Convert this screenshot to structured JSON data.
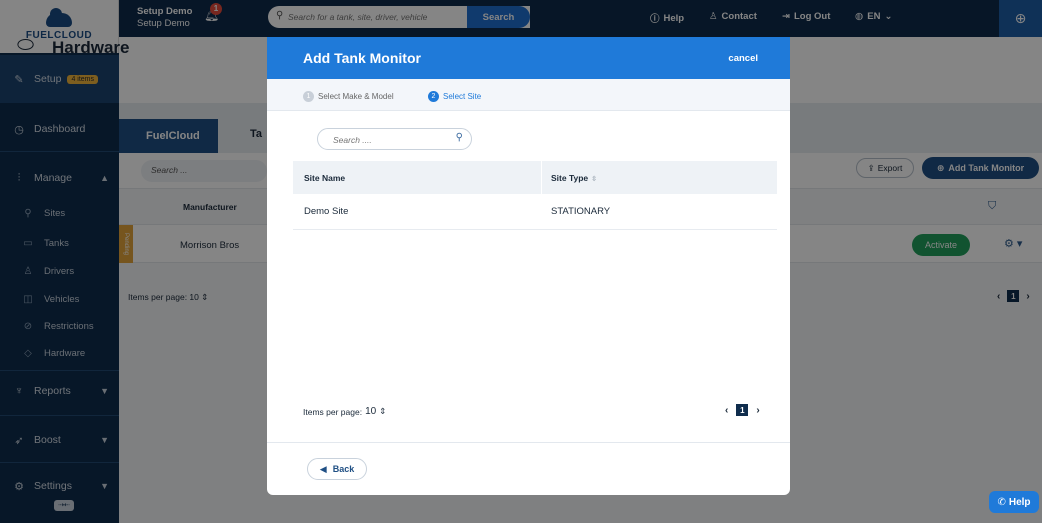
{
  "brand": {
    "logo_text": "FUELCLOUD"
  },
  "sidebar": {
    "setup_label": "Setup",
    "setup_badge": "4 items",
    "dashboard_label": "Dashboard",
    "manage_label": "Manage",
    "manage_items": [
      {
        "label": "Sites",
        "icon": "pin-icon"
      },
      {
        "label": "Tanks",
        "icon": "tank-icon"
      },
      {
        "label": "Drivers",
        "icon": "driver-icon"
      },
      {
        "label": "Vehicles",
        "icon": "vehicle-icon"
      },
      {
        "label": "Restrictions",
        "icon": "restriction-icon"
      },
      {
        "label": "Hardware",
        "icon": "hardware-icon"
      }
    ],
    "reports_label": "Reports",
    "boost_label": "Boost",
    "settings_label": "Settings"
  },
  "topbar": {
    "user_line1": "Setup Demo",
    "user_line2": "Setup Demo",
    "notification_count": "1",
    "search_placeholder": "Search for a tank, site, driver, vehicle",
    "search_button": "Search",
    "help": "Help",
    "contact": "Contact",
    "logout": "Log Out",
    "language": "EN"
  },
  "page": {
    "title": "Hardware",
    "tab_active": "FuelCloud",
    "tab_other": "Ta",
    "search_placeholder": "Search ...",
    "export_label": "Export",
    "add_button": "Add Tank Monitor",
    "column_manufacturer": "Manufacturer",
    "row_status": "Pending",
    "row_manufacturer": "Morrison Bros",
    "activate_label": "Activate",
    "items_per_page": "Items per page:  10",
    "current_page": "1"
  },
  "modal": {
    "title": "Add Tank Monitor",
    "cancel": "cancel",
    "steps": [
      {
        "num": "1",
        "label": "Select Make & Model"
      },
      {
        "num": "2",
        "label": "Select Site"
      }
    ],
    "search_placeholder": "Search ....",
    "columns": {
      "site_name": "Site Name",
      "site_type": "Site Type"
    },
    "rows": [
      {
        "site_name": "Demo Site",
        "site_type": "STATIONARY"
      }
    ],
    "items_per_page_label": "Items per page:",
    "items_per_page_value": "10",
    "current_page": "1",
    "back": "Back"
  },
  "help_fab": "Help",
  "colors": {
    "primary": "#1f7ad9",
    "navy": "#0f2d4d",
    "success": "#21a05c",
    "warning": "#e3a33a"
  }
}
